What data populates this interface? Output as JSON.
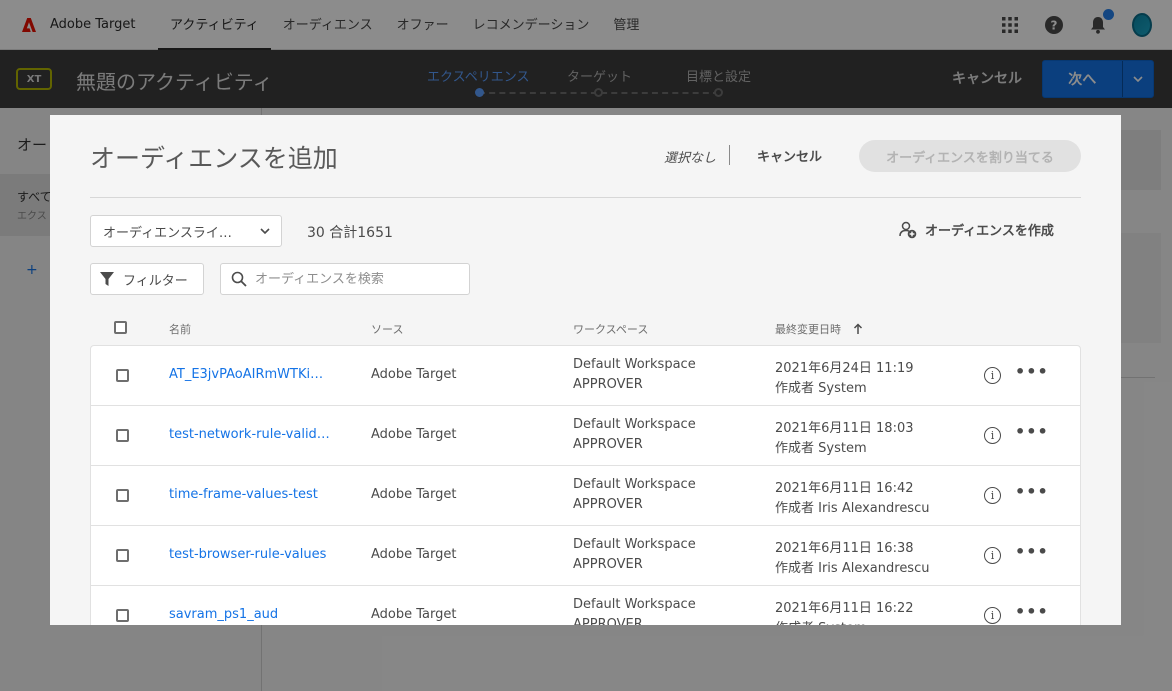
{
  "app": {
    "name": "Adobe Target",
    "brand_color": "#eb1000"
  },
  "nav": {
    "tabs": [
      {
        "label": "アクティビティ",
        "active": true
      },
      {
        "label": "オーディエンス",
        "active": false
      },
      {
        "label": "オファー",
        "active": false
      },
      {
        "label": "レコメンデーション",
        "active": false
      },
      {
        "label": "管理",
        "active": false
      }
    ],
    "icons": [
      "apps-grid-icon",
      "help-icon",
      "bell-icon",
      "avatar"
    ]
  },
  "activity": {
    "badge": "XT",
    "title": "無題のアクティビティ",
    "steps": [
      {
        "label": "エクスペリエンス",
        "active": true
      },
      {
        "label": "ターゲット",
        "active": false
      },
      {
        "label": "目標と設定",
        "active": false
      }
    ],
    "cancel_label": "キャンセル",
    "next_label": "次へ"
  },
  "background": {
    "left_head": "オー",
    "left_item_title": "すべて",
    "left_item_sub": "エクス",
    "add": "+"
  },
  "modal": {
    "title": "オーディエンスを追加",
    "selection_text": "選択なし",
    "cancel_label": "キャンセル",
    "assign_label": "オーディエンスを割り当てる",
    "library_select": "オーディエンスライ…",
    "count_text": "30 合計1651",
    "create_label": "オーディエンスを作成",
    "filter_label": "フィルター",
    "search_placeholder": "オーディエンスを検索",
    "columns": {
      "name": "名前",
      "source": "ソース",
      "workspace": "ワークスペース",
      "modified": "最終変更日時"
    },
    "rows": [
      {
        "name": "AT_E3jvPAoAIRmWTKi…",
        "source": "Adobe Target",
        "workspace": "Default Workspace",
        "role": "APPROVER",
        "date": "2021年6月24日 11:19",
        "author": "作成者 System"
      },
      {
        "name": "test-network-rule-valid…",
        "source": "Adobe Target",
        "workspace": "Default Workspace",
        "role": "APPROVER",
        "date": "2021年6月11日 18:03",
        "author": "作成者 System"
      },
      {
        "name": "time-frame-values-test",
        "source": "Adobe Target",
        "workspace": "Default Workspace",
        "role": "APPROVER",
        "date": "2021年6月11日 16:42",
        "author": "作成者 Iris Alexandrescu"
      },
      {
        "name": "test-browser-rule-values",
        "source": "Adobe Target",
        "workspace": "Default Workspace",
        "role": "APPROVER",
        "date": "2021年6月11日 16:38",
        "author": "作成者 Iris Alexandrescu"
      },
      {
        "name": "savram_ps1_aud",
        "source": "Adobe Target",
        "workspace": "Default Workspace",
        "role": "APPROVER",
        "date": "2021年6月11日 16:22",
        "author": "作成者 System"
      }
    ]
  }
}
